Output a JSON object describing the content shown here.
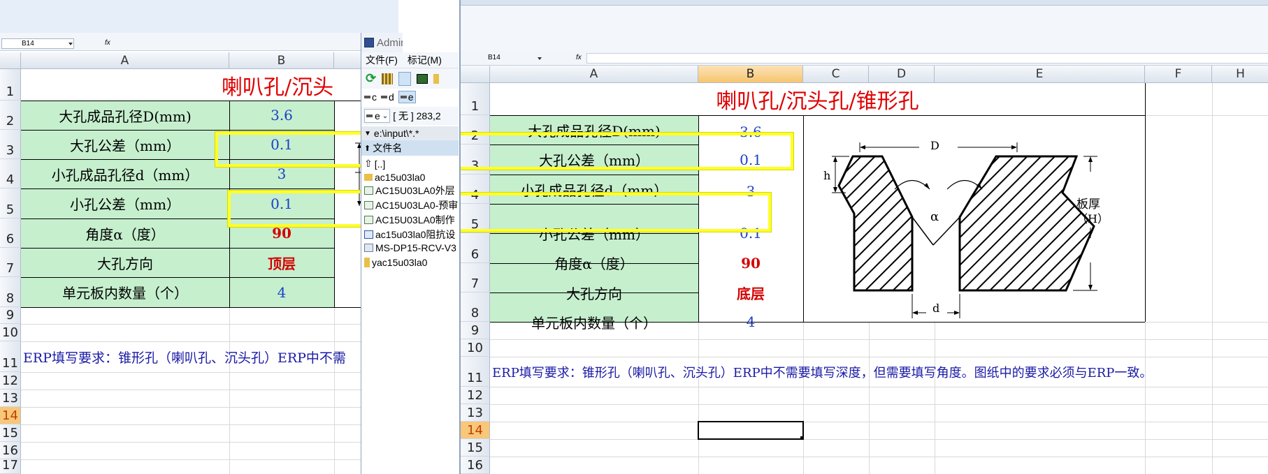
{
  "left_sheet": {
    "name_box": "B14",
    "fx_label": "fx",
    "columns": [
      "A",
      "B"
    ],
    "rows": [
      "1",
      "2",
      "3",
      "4",
      "5",
      "6",
      "7",
      "8",
      "9",
      "10",
      "11",
      "12",
      "13",
      "14",
      "15",
      "16",
      "17"
    ],
    "title": "喇叭孔/沉头",
    "items": [
      {
        "label": "大孔成品孔径D(mm)",
        "value": "3.6"
      },
      {
        "label": "大孔公差（mm）",
        "value": "0.1"
      },
      {
        "label": "小孔成品孔径d（mm）",
        "value": "3"
      },
      {
        "label": "小孔公差（mm）",
        "value": "0.1"
      },
      {
        "label": "角度α（度）",
        "value": "90"
      },
      {
        "label": "大孔方向",
        "value": "顶层"
      },
      {
        "label": "单元板内数量（个）",
        "value": "4"
      }
    ],
    "note": "ERP填写要求：锥形孔（喇叭孔、沉头孔）ERP中不需"
  },
  "file_manager": {
    "title": "Administrator^",
    "menu": [
      "文件(F)",
      "标记(M)"
    ],
    "drives": [
      "c",
      "d",
      "e"
    ],
    "drive_select": "e",
    "drive_info": "[ 无 ]  283,2",
    "path": "e:\\input\\*.*",
    "column_header": "文件名",
    "files": [
      "[..]",
      "ac15u03la0",
      "AC15U03LA0外层",
      "AC15U03LA0-预审",
      "AC15U03LA0制作",
      "ac15u03la0阻抗设",
      "MS-DP15-RCV-V3",
      "yac15u03la0"
    ]
  },
  "right_sheet": {
    "name_box": "B14",
    "fx_label": "fx",
    "columns": [
      "A",
      "B",
      "C",
      "D",
      "E",
      "F",
      "H"
    ],
    "rows": [
      "1",
      "2",
      "3",
      "4",
      "5",
      "6",
      "7",
      "8",
      "9",
      "10",
      "11",
      "12",
      "13",
      "14",
      "15",
      "16"
    ],
    "title": "喇叭孔/沉头孔/锥形孔",
    "items": [
      {
        "label": "大孔成品孔径D(mm)",
        "value": "3.6"
      },
      {
        "label": "大孔公差（mm）",
        "value": "0.1"
      },
      {
        "label": "小孔成品孔径d（mm）",
        "value": "3"
      },
      {
        "label": "小孔公差（mm）",
        "value": "0.1"
      },
      {
        "label": "角度α（度）",
        "value": "90"
      },
      {
        "label": "大孔方向",
        "value": "底层"
      },
      {
        "label": "单元板内数量（个）",
        "value": "4"
      }
    ],
    "note": "ERP填写要求：锥形孔（喇叭孔、沉头孔）ERP中不需要填写深度，但需要填写角度。图纸中的要求必须与ERP一致。",
    "diagram": {
      "D": "D",
      "d": "d",
      "h": "h",
      "alpha": "α",
      "thickness_label": "板厚",
      "thickness_sym": "（H）"
    }
  },
  "colors": {
    "value_blue": "#1a40c8",
    "value_red": "#d40000",
    "title_red": "#e00000",
    "label_green": "#c6efce",
    "highlight": "#ffff29"
  }
}
